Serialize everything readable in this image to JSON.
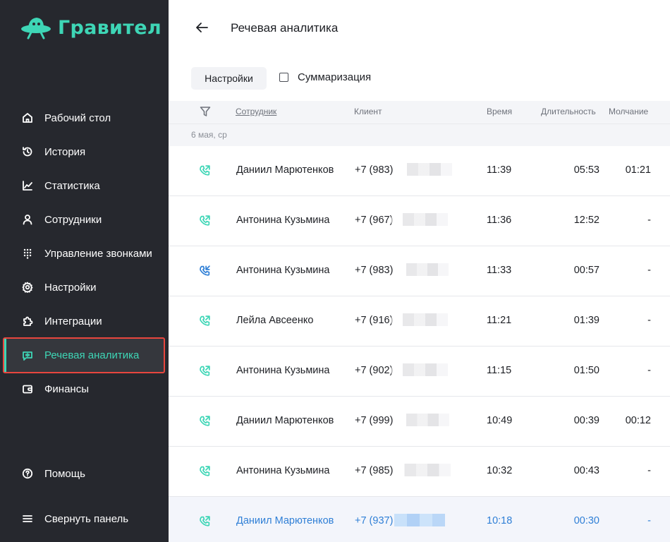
{
  "app": {
    "logo_text": "Гравител"
  },
  "sidebar": {
    "items": [
      {
        "label": "Рабочий стол",
        "icon": "home-icon"
      },
      {
        "label": "История",
        "icon": "history-icon"
      },
      {
        "label": "Статистика",
        "icon": "chart-icon"
      },
      {
        "label": "Сотрудники",
        "icon": "user-icon"
      },
      {
        "label": "Управление звонками",
        "icon": "dialpad-icon"
      },
      {
        "label": "Настройки",
        "icon": "gear-icon"
      },
      {
        "label": "Интеграции",
        "icon": "puzzle-icon"
      },
      {
        "label": "Речевая аналитика",
        "icon": "speech-icon",
        "active": true
      },
      {
        "label": "Финансы",
        "icon": "wallet-icon"
      }
    ],
    "help": {
      "label": "Помощь",
      "icon": "help-icon"
    },
    "collapse": {
      "label": "Свернуть панель",
      "icon": "menu-icon"
    }
  },
  "header": {
    "title": "Речевая аналитика"
  },
  "toolbar": {
    "settings_label": "Настройки",
    "summarization_label": "Суммаризация"
  },
  "table": {
    "columns": {
      "employee": "Сотрудник",
      "client": "Клиент",
      "time": "Время",
      "duration": "Длительность",
      "silence": "Молчание"
    },
    "date_group": "6 мая, ср",
    "rows": [
      {
        "direction": "outgoing",
        "employee": "Даниил Марютенков",
        "client": "+7 (983)",
        "time": "11:39",
        "duration": "05:53",
        "silence": "01:21"
      },
      {
        "direction": "outgoing",
        "employee": "Антонина Кузьмина",
        "client": "+7 (967)",
        "time": "11:36",
        "duration": "12:52",
        "silence": "-"
      },
      {
        "direction": "incoming",
        "employee": "Антонина Кузьмина",
        "client": "+7 (983)",
        "time": "11:33",
        "duration": "00:57",
        "silence": "-"
      },
      {
        "direction": "outgoing",
        "employee": "Лейла Авсеенко",
        "client": "+7 (916)",
        "time": "11:21",
        "duration": "01:39",
        "silence": "-"
      },
      {
        "direction": "outgoing",
        "employee": "Антонина Кузьмина",
        "client": "+7 (902)",
        "time": "11:15",
        "duration": "01:50",
        "silence": "-"
      },
      {
        "direction": "outgoing",
        "employee": "Даниил Марютенков",
        "client": "+7 (999)",
        "time": "10:49",
        "duration": "00:39",
        "silence": "00:12"
      },
      {
        "direction": "outgoing",
        "employee": "Антонина Кузьмина",
        "client": "+7 (985)",
        "time": "10:32",
        "duration": "00:43",
        "silence": "-"
      },
      {
        "direction": "outgoing",
        "employee": "Даниил Марютенков",
        "client": "+7 (937)",
        "time": "10:18",
        "duration": "00:30",
        "silence": "-",
        "highlighted": true
      }
    ]
  },
  "colors": {
    "accent": "#3ed6b6",
    "sidebar_bg": "#26282e",
    "active_border": "#e8463e",
    "incoming": "#2f7fd6",
    "link": "#2f7fd6"
  }
}
